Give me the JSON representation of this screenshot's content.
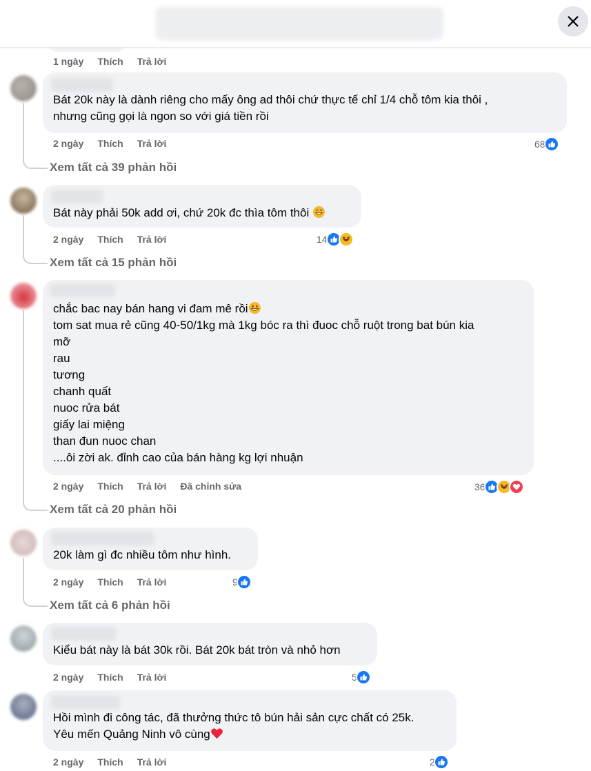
{
  "header": {
    "title": "",
    "close_icon": "close-icon"
  },
  "comments": [
    {
      "actions": {
        "time": "1 ngày",
        "like": "Thích",
        "reply": "Trả lời"
      }
    },
    {
      "lines": [
        "Bát 20k này là dành riêng cho mấy ông ad thôi chứ thực tế chỉ 1/4 chỗ tôm kia thôi ,",
        "nhưng cũng gọi là ngon so với giá tiền rồi"
      ],
      "actions": {
        "time": "2 ngày",
        "like": "Thích",
        "reply": "Trả lời"
      },
      "reaction_count": "68",
      "reactions": [
        "like"
      ],
      "view_all": "Xem tất cả 39 phản hồi"
    },
    {
      "lines": [
        "Bát này phải 50k add ơi, chứ 20k đc thìa tôm thôi"
      ],
      "trailing_emoji": "grin-sweat-emoji",
      "actions": {
        "time": "2 ngày",
        "like": "Thích",
        "reply": "Trả lời"
      },
      "reaction_count": "14",
      "reactions": [
        "like",
        "haha"
      ],
      "view_all": "Xem tất cả 15 phản hồi"
    },
    {
      "lines": [
        "chắc bac nay bán hang vi đam mê rồi",
        "tom sat mua rẻ cũng 40-50/1kg mà 1kg bóc ra thì đuoc chỗ ruột trong bat bún kia",
        "mỡ",
        "rau",
        "tương",
        "chanh quất",
        "nuoc rửa bát",
        "giấy lai miệng",
        "than đun nuoc chan",
        "....ôi zời ak. đỉnh cao của bán hàng kg lợi nhuận"
      ],
      "first_line_emoji": "grinning-emoji",
      "actions": {
        "time": "2 ngày",
        "like": "Thích",
        "reply": "Trả lời",
        "edited": "Đã chỉnh sửa"
      },
      "reaction_count": "36",
      "reactions": [
        "like",
        "haha",
        "love"
      ],
      "view_all": "Xem tất cả 20 phản hồi"
    },
    {
      "lines": [
        "20k làm gì đc nhiều tôm như hình."
      ],
      "actions": {
        "time": "2 ngày",
        "like": "Thích",
        "reply": "Trả lời"
      },
      "reaction_count": "9",
      "reactions": [
        "like"
      ],
      "view_all": "Xem tất cả 6 phản hồi"
    },
    {
      "lines": [
        "Kiểu bát này là bát 30k rồi. Bát 20k bát tròn và nhỏ hơn"
      ],
      "actions": {
        "time": "2 ngày",
        "like": "Thích",
        "reply": "Trả lời"
      },
      "reaction_count": "5",
      "reactions": [
        "like"
      ]
    },
    {
      "lines": [
        "Hồi mình đi công tác, đã thưởng thức tô bún hải sản cực chất có 25k.",
        "Yêu mến Quảng Ninh vô cùng"
      ],
      "trailing_emoji": "red-heart-emoji",
      "actions": {
        "time": "2 ngày",
        "like": "Thích",
        "reply": "Trả lời"
      },
      "reaction_count": "2",
      "reactions": [
        "like"
      ]
    }
  ],
  "colors": {
    "bubble": "#f0f2f5",
    "muted_text": "#65676b",
    "like_blue": "#1877f2",
    "love_red": "#f33e58",
    "haha_yellow": "#f7b928"
  }
}
